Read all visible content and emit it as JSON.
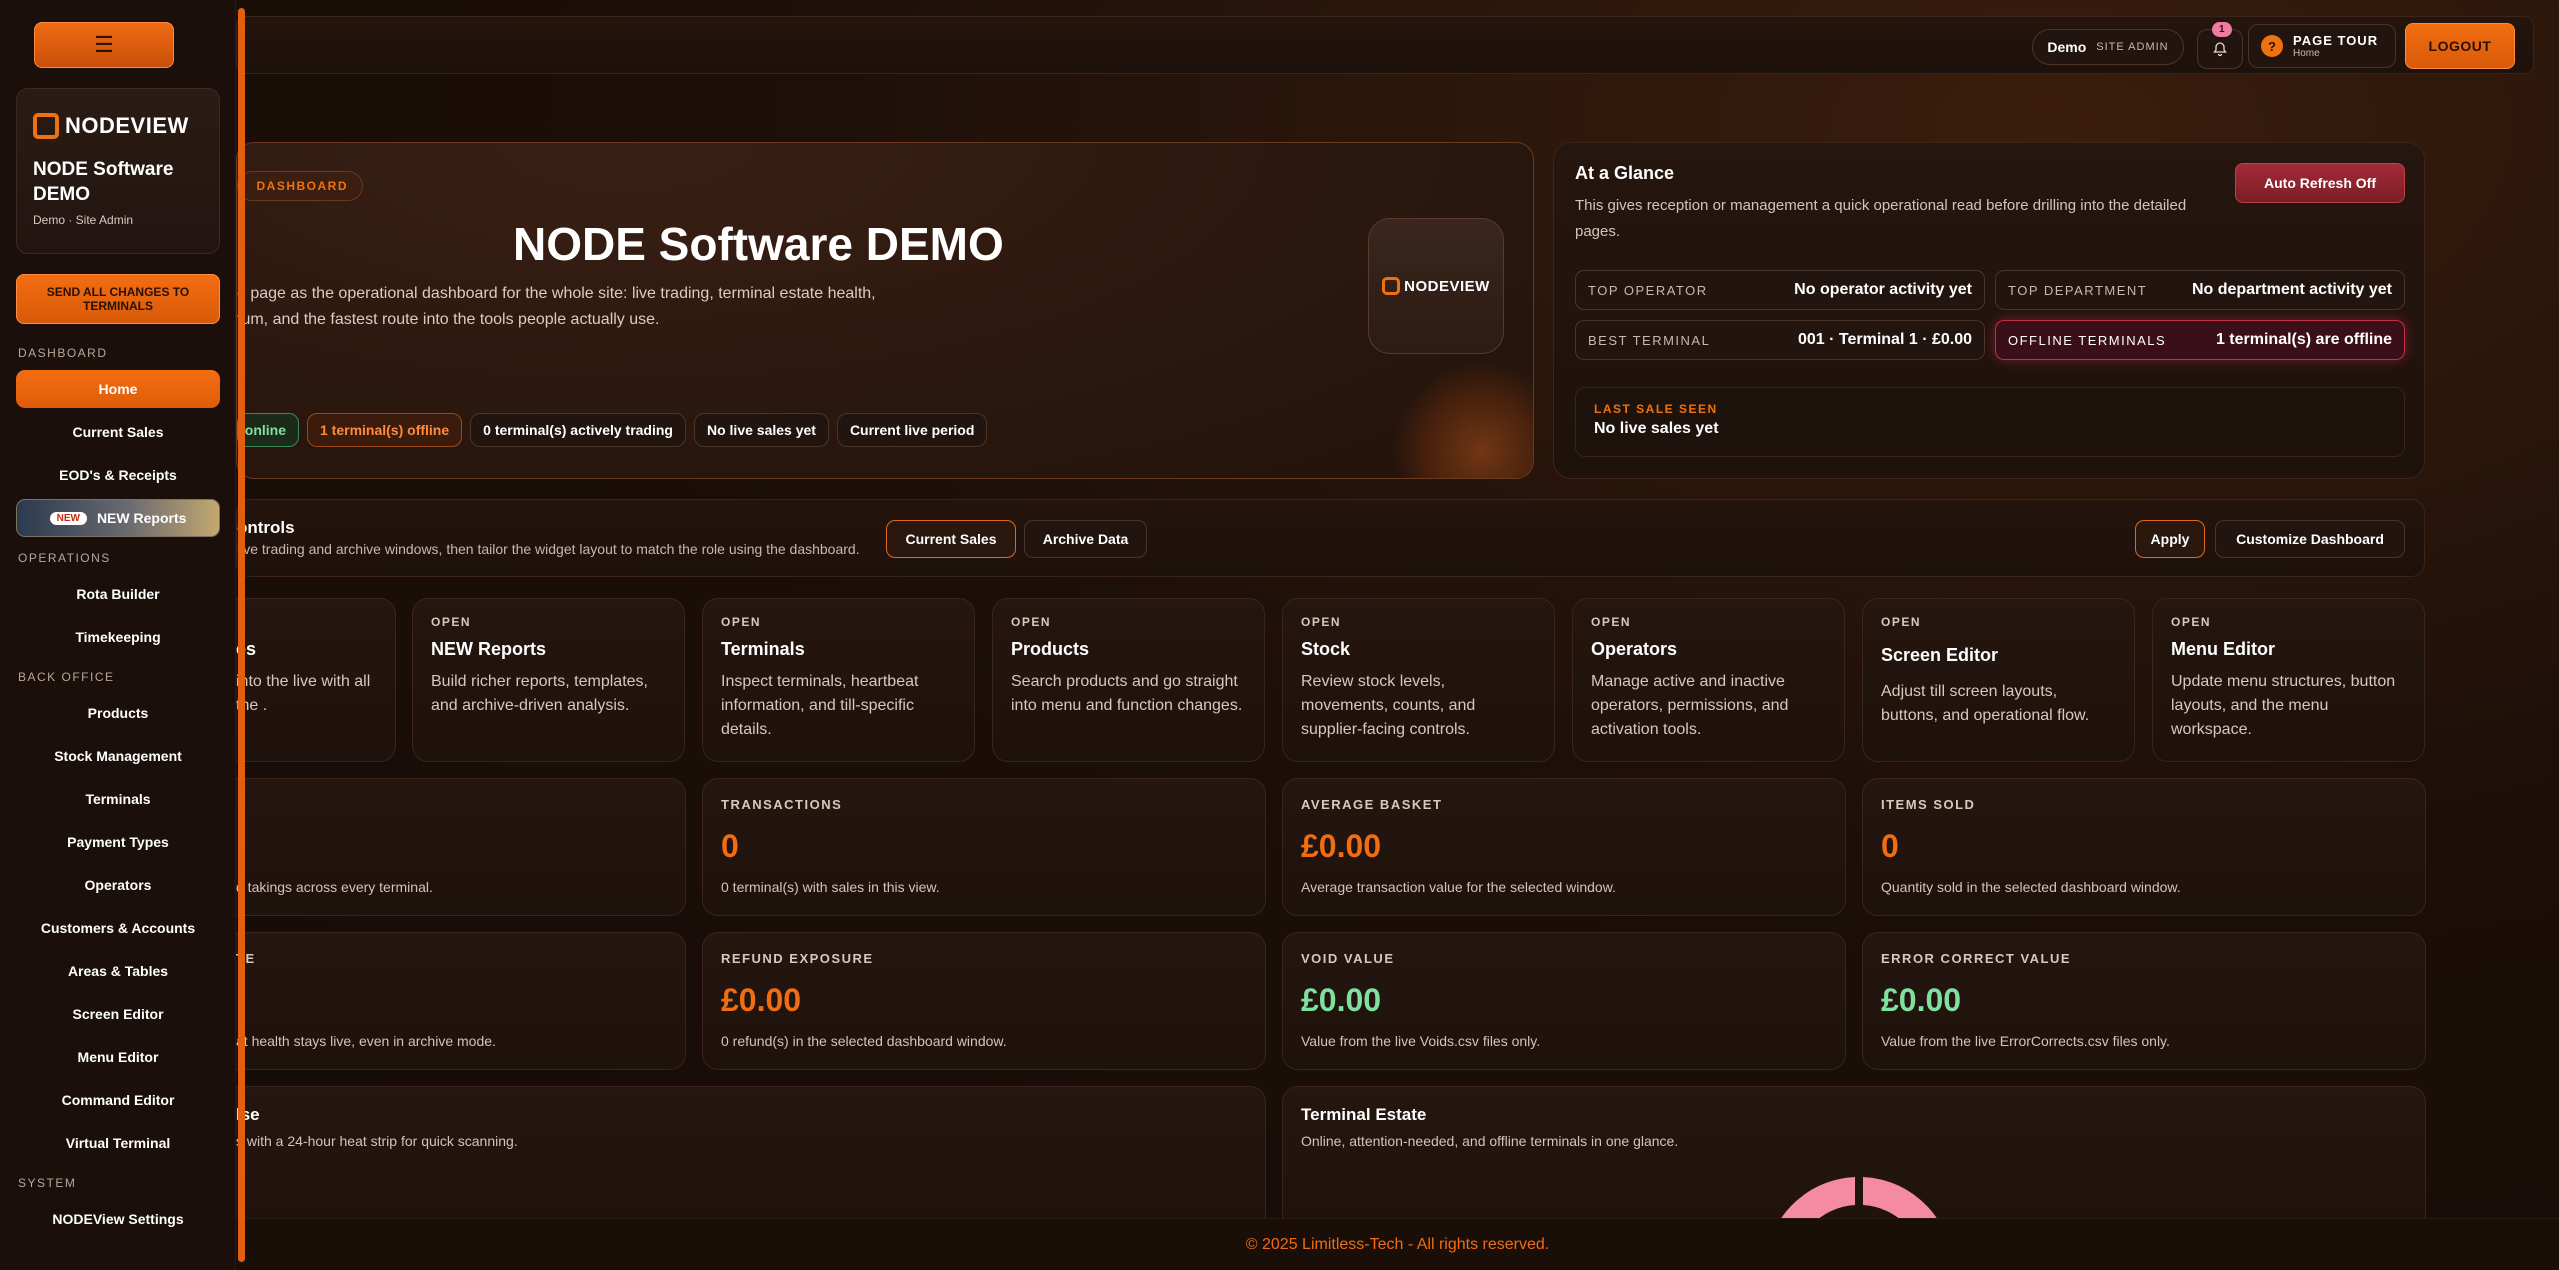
{
  "sidebar": {
    "menu_icon": "hamburger-icon",
    "logo_text": "NODEVIEW",
    "brand_title": "NODE Software DEMO",
    "brand_sub": "Demo · Site Admin",
    "send_label": "SEND ALL CHANGES TO TERMINALS",
    "sections": {
      "dashboard": "DASHBOARD",
      "operations": "OPERATIONS",
      "back_office": "BACK OFFICE",
      "system": "SYSTEM"
    },
    "dashboard_items": [
      "Home",
      "Current Sales",
      "EOD's & Receipts"
    ],
    "new_badge": "NEW",
    "new_reports_label": "NEW Reports",
    "operations_items": [
      "Rota Builder",
      "Timekeeping"
    ],
    "back_office_items": [
      "Products",
      "Stock Management",
      "Terminals",
      "Payment Types",
      "Operators",
      "Customers & Accounts",
      "Areas & Tables",
      "Screen Editor",
      "Menu Editor",
      "Command Editor",
      "Virtual Terminal"
    ],
    "system_items": [
      "NODEView Settings"
    ]
  },
  "topbar": {
    "demo_name": "Demo",
    "demo_role": "SITE ADMIN",
    "notification_count": "1",
    "tour_title": "PAGE TOUR",
    "tour_sub": "Home",
    "logout_label": "LOGOUT"
  },
  "hero": {
    "tag": "DASHBOARD",
    "title": "NODE Software DEMO",
    "desc_line1": "e page as the operational dashboard for the whole site: live trading, terminal estate health,",
    "desc_line2": "tum, and the fastest route into the tools people actually use.",
    "logo_text": "NODEVIEW",
    "chips": [
      "online",
      "1 terminal(s) offline",
      "0 terminal(s) actively trading",
      "No live sales yet",
      "Current live period"
    ]
  },
  "glance": {
    "title": "At a Glance",
    "desc": "This gives reception or management a quick operational read before drilling into the detailed pages.",
    "auto_refresh": "Auto Refresh Off",
    "top_operator_k": "TOP OPERATOR",
    "top_operator_v": "No operator activity yet",
    "top_department_k": "TOP DEPARTMENT",
    "top_department_v": "No department activity yet",
    "best_terminal_k": "BEST TERMINAL",
    "best_terminal_v": "001 · Terminal 1 · £0.00",
    "offline_k": "OFFLINE TERMINALS",
    "offline_v": "1 terminal(s) are offline",
    "last_sale_k": "LAST SALE SEEN",
    "last_sale_v": "No live sales yet"
  },
  "controls": {
    "title": "ontrols",
    "desc": "live trading and archive windows, then tailor the widget layout to match the role using the dashboard.",
    "current_sales": "Current Sales",
    "archive_data": "Archive Data",
    "apply": "Apply",
    "customize": "Customize Dashboard"
  },
  "quick_cards": [
    {
      "open": "",
      "name": "es",
      "desc": "into the live with all the ."
    },
    {
      "open": "OPEN",
      "name": "NEW Reports",
      "desc": "Build richer reports, templates, and archive-driven analysis."
    },
    {
      "open": "OPEN",
      "name": "Terminals",
      "desc": "Inspect terminals, heartbeat information, and till-specific details."
    },
    {
      "open": "OPEN",
      "name": "Products",
      "desc": "Search products and go straight into menu and function changes."
    },
    {
      "open": "OPEN",
      "name": "Stock",
      "desc": "Review stock levels, movements, counts, and supplier-facing controls."
    },
    {
      "open": "OPEN",
      "name": "Operators",
      "desc": "Manage active and inactive operators, permissions, and activation tools."
    },
    {
      "open": "OPEN",
      "name": "Screen Editor",
      "desc": "Adjust till screen layouts, buttons, and operational flow."
    },
    {
      "open": "OPEN",
      "name": "Menu Editor",
      "desc": "Update menu structures, button layouts, and the menu workspace."
    }
  ],
  "metrics_row1": [
    {
      "k": "",
      "v": "",
      "s": "d takings across every terminal."
    },
    {
      "k": "TRANSACTIONS",
      "v": "0",
      "s": "0 terminal(s) with sales in this view."
    },
    {
      "k": "AVERAGE BASKET",
      "v": "£0.00",
      "s": "Average transaction value for the selected window."
    },
    {
      "k": "ITEMS SOLD",
      "v": "0",
      "s": "Quantity sold in the selected dashboard window."
    }
  ],
  "metrics_row2": [
    {
      "k": "TE",
      "v": "",
      "s": "at health stays live, even in archive mode."
    },
    {
      "k": "REFUND EXPOSURE",
      "v": "£0.00",
      "s": "0 refund(s) in the selected dashboard window."
    },
    {
      "k": "VOID VALUE",
      "v": "£0.00",
      "s": "Value from the live Voids.csv files only."
    },
    {
      "k": "ERROR CORRECT VALUE",
      "v": "£0.00",
      "s": "Value from the live ErrorCorrects.csv files only."
    }
  ],
  "pulse": {
    "title": "lse",
    "desc": "s with a 24-hour heat strip for quick scanning."
  },
  "estate": {
    "title": "Terminal Estate",
    "desc": "Online, attention-needed, and offline terminals in one glance."
  },
  "footer": "© 2025 Limitless-Tech - All rights reserved.",
  "colors": {
    "accent": "#f06d12",
    "success": "#7fe0a0",
    "danger": "#c0304a",
    "donut_pink": "#f48aa4"
  }
}
